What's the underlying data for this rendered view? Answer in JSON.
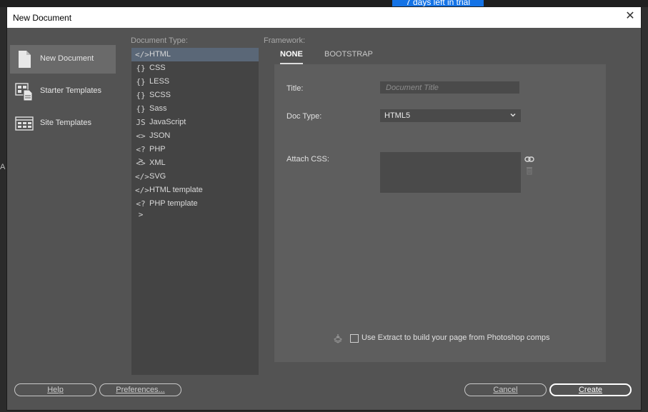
{
  "background": {
    "trial_text": "7 days left in trial",
    "left_char": "A"
  },
  "dialog": {
    "title": "New Document",
    "close_glyph": "✕"
  },
  "left_nav": {
    "items": [
      {
        "label": "New Document",
        "icon": "document-icon",
        "active": true
      },
      {
        "label": "Starter Templates",
        "icon": "starter-templates-icon",
        "active": false
      },
      {
        "label": "Site Templates",
        "icon": "site-templates-icon",
        "active": false
      }
    ]
  },
  "document_type": {
    "label": "Document Type:",
    "items": [
      {
        "label": "HTML",
        "icon": "</>",
        "active": true
      },
      {
        "label": "CSS",
        "icon": "{}"
      },
      {
        "label": "LESS",
        "icon": "{}"
      },
      {
        "label": "SCSS",
        "icon": "{}"
      },
      {
        "label": "Sass",
        "icon": "{}"
      },
      {
        "label": "JavaScript",
        "icon": "JS"
      },
      {
        "label": "JSON",
        "icon": "<>"
      },
      {
        "label": "PHP",
        "icon": "<?>"
      },
      {
        "label": "XML",
        "icon": "<>"
      },
      {
        "label": "SVG",
        "icon": "</>"
      },
      {
        "label": "HTML template",
        "icon": "</>"
      },
      {
        "label": "PHP template",
        "icon": "<?>"
      }
    ]
  },
  "framework": {
    "label": "Framework:",
    "tabs": [
      {
        "label": "NONE",
        "active": true
      },
      {
        "label": "BOOTSTRAP",
        "active": false
      }
    ],
    "title_label": "Title:",
    "title_placeholder": "Document Title",
    "title_value": "",
    "doctype_label": "Doc Type:",
    "doctype_value": "HTML5",
    "attach_css_label": "Attach CSS:",
    "extract_label": "Use Extract to build your page from Photoshop comps",
    "extract_checked": false
  },
  "buttons": {
    "help": "Help",
    "preferences": "Preferences...",
    "cancel": "Cancel",
    "create": "Create"
  },
  "colors": {
    "dialog_bg": "#535353",
    "selection": "#5a6777",
    "accent_trial": "#1473e6"
  }
}
